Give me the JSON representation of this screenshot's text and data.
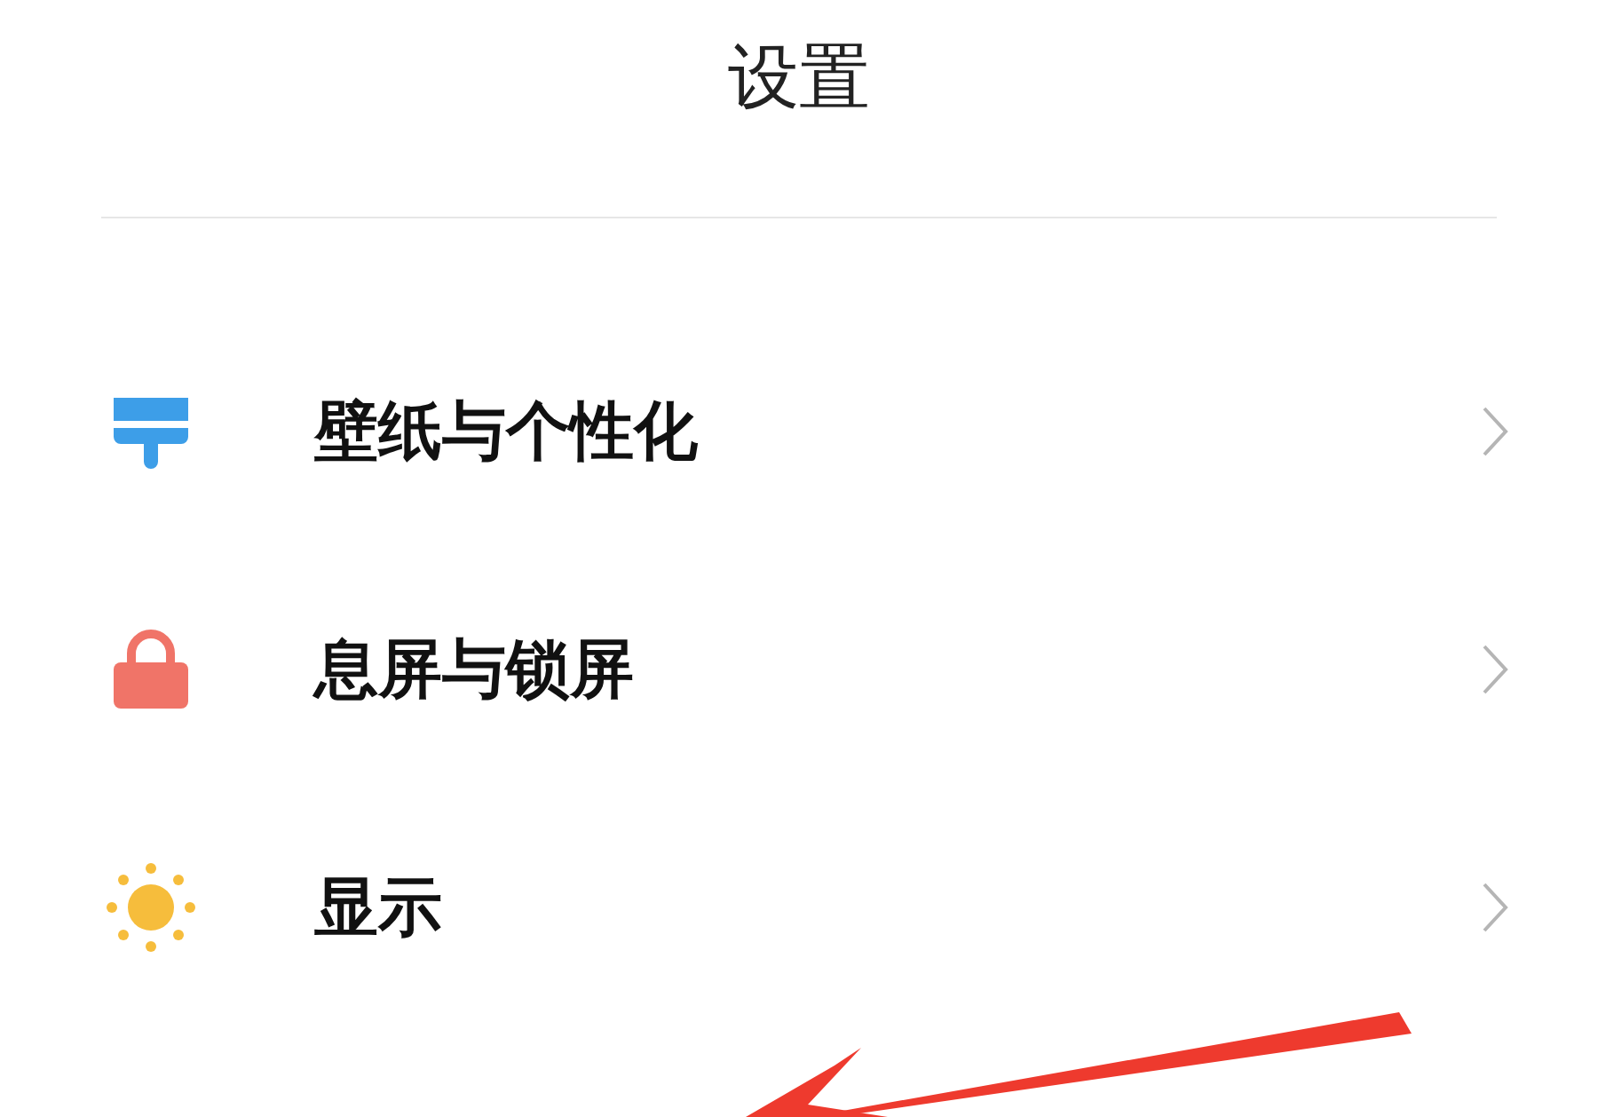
{
  "title": "设置",
  "items": [
    {
      "label": "壁纸与个性化"
    },
    {
      "label": "息屏与锁屏"
    },
    {
      "label": "显示"
    }
  ],
  "annotation": {
    "kind": "arrow",
    "color": "#ee3a2e"
  }
}
